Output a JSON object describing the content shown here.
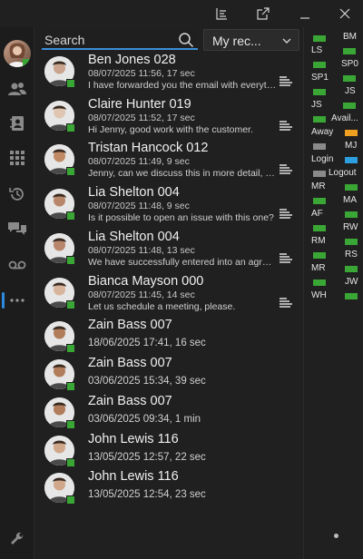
{
  "search": {
    "placeholder": "Search"
  },
  "filter": {
    "selected": "My rec..."
  },
  "colors": {
    "accent": "#3b8fd8",
    "online": "#3aa635",
    "away": "#f0a020",
    "login": "#2d9fe0",
    "logout": "#8a8a8a"
  },
  "entries": [
    {
      "name": "Ben Jones 028",
      "meta": "08/07/2025 11:56, 17 sec",
      "message": "I have forwarded you the email with everything."
    },
    {
      "name": "Claire Hunter 019",
      "meta": "08/07/2025 11:52, 17 sec",
      "message": "Hi Jenny, good work with the customer."
    },
    {
      "name": "Tristan Hancock 012",
      "meta": "08/07/2025 11:49, 9 sec",
      "message": "Jenny, can we discuss this in more detail, please?"
    },
    {
      "name": "Lia Shelton 004",
      "meta": "08/07/2025 11:48, 9 sec",
      "message": "Is it possible to open an issue with this one?"
    },
    {
      "name": "Lia Shelton 004",
      "meta": "08/07/2025 11:48, 13 sec",
      "message": "We have successfully entered into an agreement."
    },
    {
      "name": "Bianca Mayson 000",
      "meta": "08/07/2025 11:45, 14 sec",
      "message": "Let us schedule a meeting, please."
    },
    {
      "name": "Zain Bass 007",
      "meta": "18/06/2025 17:41, 16 sec"
    },
    {
      "name": "Zain Bass 007",
      "meta": "03/06/2025 15:34, 39 sec"
    },
    {
      "name": "Zain Bass 007",
      "meta": "03/06/2025 09:34, 1 min"
    },
    {
      "name": "John Lewis 116",
      "meta": "13/05/2025 12:57, 22 sec"
    },
    {
      "name": "John Lewis 116",
      "meta": "13/05/2025 12:54, 23 sec"
    }
  ],
  "status_panel": [
    {
      "label": "BM",
      "color": "#3aa635"
    },
    {
      "label": "LS",
      "color": "#3aa635"
    },
    {
      "label": "SP0",
      "color": "#3aa635"
    },
    {
      "label": "SP1",
      "color": "#3aa635"
    },
    {
      "label": "JS",
      "color": "#3aa635"
    },
    {
      "label": "JS",
      "color": "#3aa635"
    },
    {
      "label": "Avail...",
      "color": "#3aa635"
    },
    {
      "label": "Away",
      "color": "#f0a020"
    },
    {
      "label": "MJ",
      "color": "#8a8a8a"
    },
    {
      "label": "Login",
      "color": "#2d9fe0"
    },
    {
      "label": "Logout",
      "color": "#8a8a8a"
    },
    {
      "label": "MR",
      "color": "#3aa635"
    },
    {
      "label": "MA",
      "color": "#3aa635"
    },
    {
      "label": "AF",
      "color": "#3aa635"
    },
    {
      "label": "RW",
      "color": "#3aa635"
    },
    {
      "label": "RM",
      "color": "#3aa635"
    },
    {
      "label": "RS",
      "color": "#3aa635"
    },
    {
      "label": "MR",
      "color": "#3aa635"
    },
    {
      "label": "JW",
      "color": "#3aa635"
    },
    {
      "label": "WH",
      "color": "#3aa635"
    }
  ]
}
